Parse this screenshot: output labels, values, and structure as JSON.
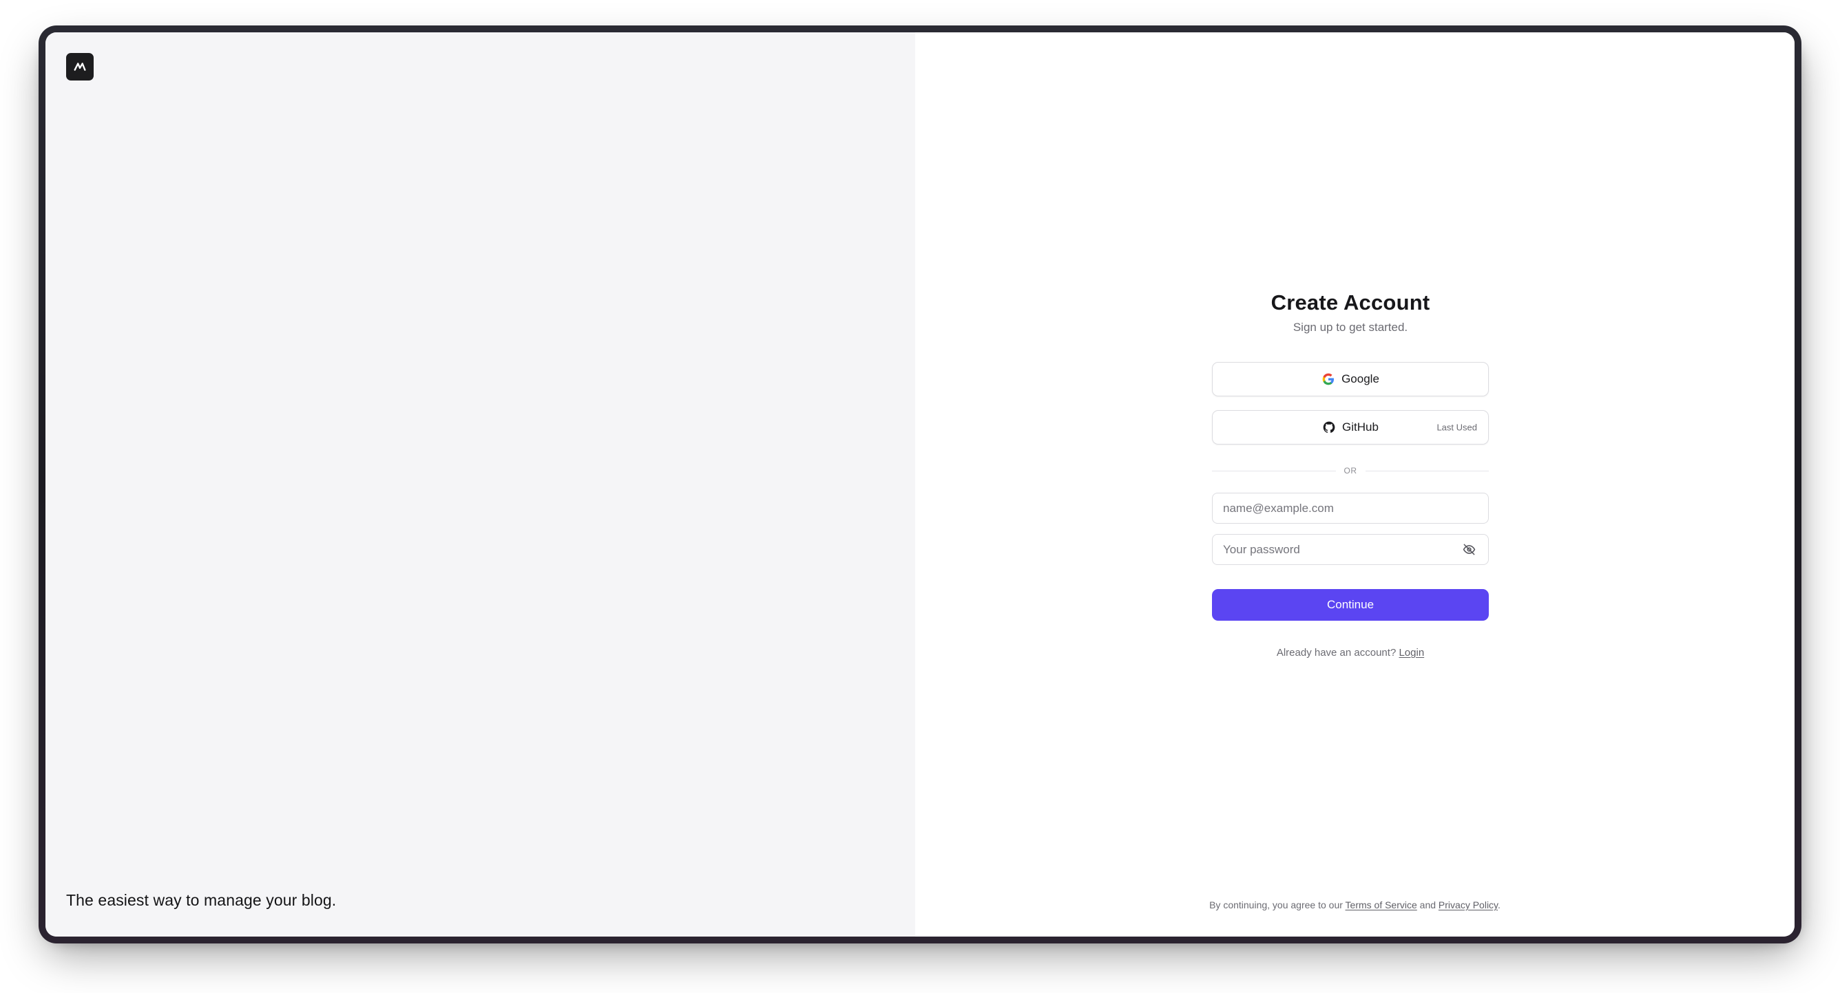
{
  "brand": {
    "logo_icon": "stylized-m-logo-icon",
    "tagline": "The easiest way to manage your blog."
  },
  "signup": {
    "title": "Create Account",
    "subtitle": "Sign up to get started.",
    "google_label": "Google",
    "google_icon": "google-icon",
    "github_label": "GitHub",
    "github_icon": "github-icon",
    "last_used_badge": "Last Used",
    "divider_text": "OR",
    "email_placeholder": "name@example.com",
    "email_value": "",
    "password_placeholder": "Your password",
    "password_value": "",
    "password_toggle_icon": "eye-off-icon",
    "continue_label": "Continue",
    "login_prompt": "Already have an account?",
    "login_link": "Login"
  },
  "footer": {
    "prefix": "By continuing, you agree to our",
    "terms_link": "Terms of Service",
    "and_text": "and",
    "privacy_link": "Privacy Policy",
    "suffix": "."
  },
  "colors": {
    "primary": "#5b45f2",
    "left_panel_bg": "#f5f5f7",
    "logo_bg": "#1d1d1f",
    "title_text": "#17171a",
    "muted_text": "#6b6b72",
    "border": "#dcdce0"
  }
}
